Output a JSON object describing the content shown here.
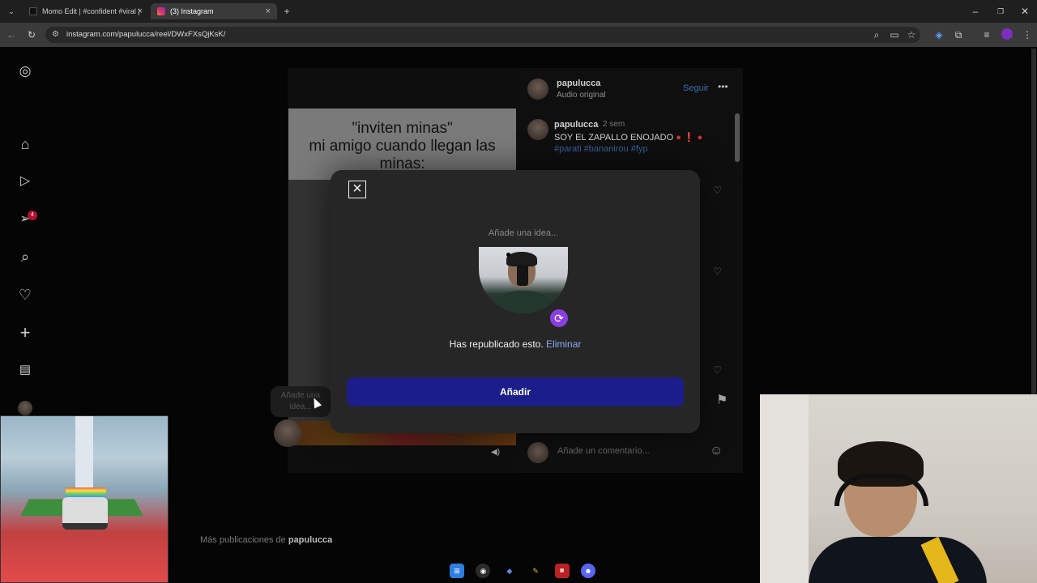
{
  "browser": {
    "tabs": [
      {
        "label": "Momo Edit | #confident #viral |",
        "active": false
      },
      {
        "label": "(3) Instagram",
        "active": true
      }
    ],
    "url": "instagram.com/papulucca/reel/DWxFXsQjKsK/",
    "new_tab_label": "+"
  },
  "nav": {
    "notification_count": "4",
    "icons": [
      "instagram-icon",
      "home-icon",
      "reels-icon",
      "messages-icon",
      "search-icon",
      "heart-icon",
      "create-icon",
      "dashboard-icon",
      "profile-icon"
    ]
  },
  "post": {
    "caption_card": "\"inviten minas\"\nmi amigo cuando llegan las minas:",
    "author": "papulucca",
    "audio": "Audio original",
    "follow": "Seguir",
    "comment": {
      "author": "papulucca",
      "time": "2 sem",
      "text": "SOY EL ZAPALLO ENOJADO",
      "tags": "#parati #bananirou #fyp"
    },
    "comment_placeholder": "Añade un comentario...",
    "idea_bubble": "Añade una idea..."
  },
  "more_posts": {
    "prefix": "Más publicaciones de ",
    "user": "papulucca"
  },
  "modal": {
    "idea_placeholder": "Añade una idea...",
    "republished_text": "Has republicado esto.",
    "remove_link": "Eliminar",
    "add_button": "Añadir"
  },
  "colors": {
    "accent": "#1b1e8a",
    "link": "#8ea8f5",
    "repost": "#8a3de0",
    "badge": "#b1102e"
  }
}
